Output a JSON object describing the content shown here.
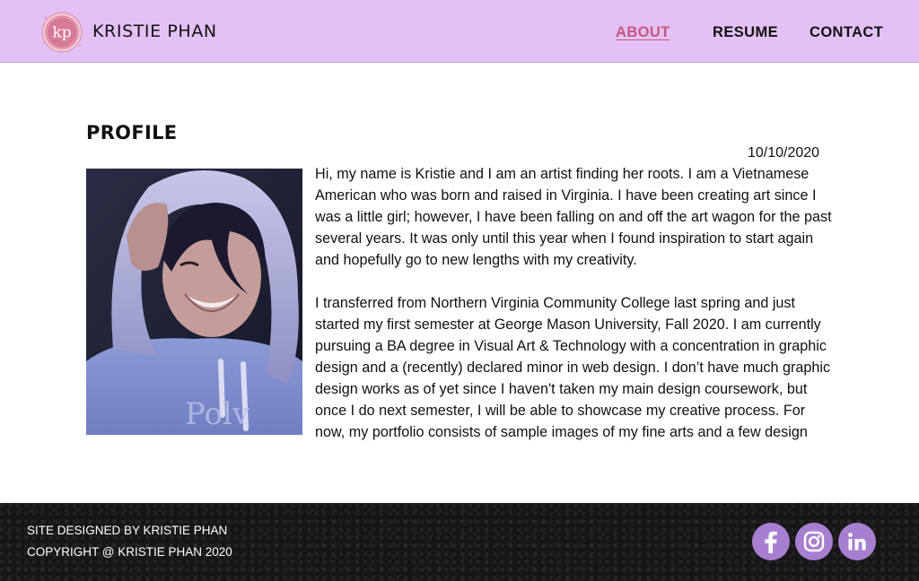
{
  "header": {
    "logo_initials": "kp",
    "brand_name": "KRISTIE PHAN",
    "nav": [
      {
        "label": "ABOUT",
        "active": true
      },
      {
        "label": "RESUME",
        "active": false
      },
      {
        "label": "CONTACT",
        "active": false
      }
    ]
  },
  "main": {
    "heading": "PROFILE",
    "date": "10/10/2020",
    "photo_text": "Polv",
    "bio_paragraphs": [
      "Hi, my name is Kristie and I am an artist finding her roots. I am a Vietnamese American who was born and raised in Virginia. I have been creating art since I was a little girl; however, I have been falling on and off the art wagon for the past several years. It was only until this year when I found inspiration to start again and hopefully go to new lengths with my creativity.",
      "I transferred from Northern Virginia Community College last spring and just started my first semester at George Mason University, Fall 2020. I am currently pursuing a BA degree in Visual Art & Technology with a concentration in graphic design and a (recently) declared minor in web design. I don’t have much graphic design works as of yet since I haven't taken my main design coursework, but once I do next semester, I will be able to showcase my creative process. For now, my portfolio consists of sample images of my fine arts and a few design"
    ]
  },
  "footer": {
    "designed_by": "SITE DESIGNED BY KRISTIE PHAN",
    "copyright": "COPYRIGHT @ KRISTIE PHAN 2020",
    "social": [
      "facebook-icon",
      "instagram-icon",
      "linkedin-icon"
    ]
  },
  "colors": {
    "header_bg": "#e3c1f7",
    "active_nav": "#c5567e",
    "footer_bg": "#161616",
    "social_bg": "#a77fd0"
  }
}
